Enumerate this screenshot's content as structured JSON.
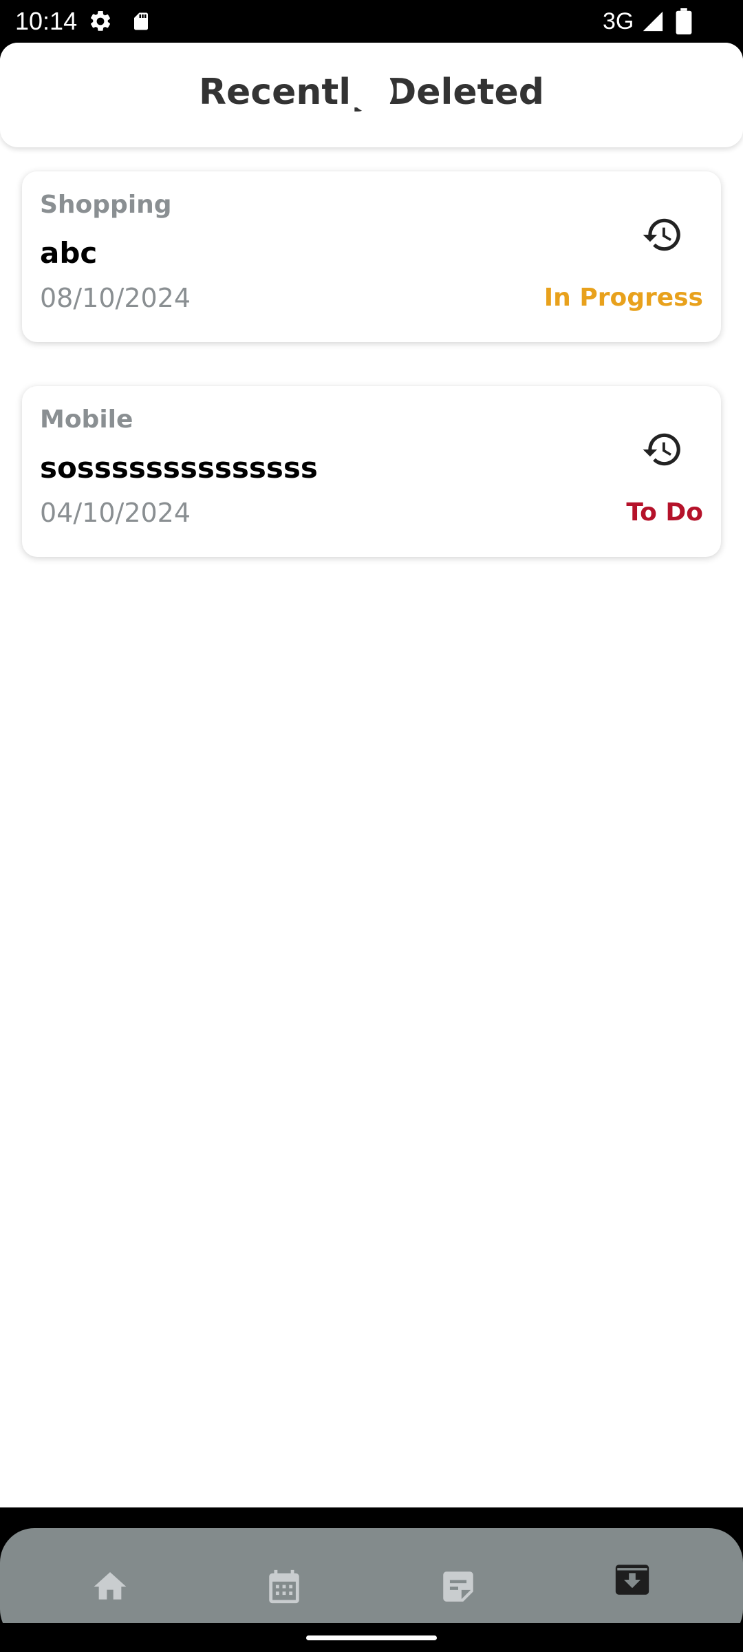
{
  "status_bar": {
    "time": "10:14",
    "network": "3G",
    "icons": [
      "settings-icon",
      "sd-card-icon",
      "signal-icon",
      "battery-icon"
    ]
  },
  "header": {
    "title": "Recently Deleted"
  },
  "cards": [
    {
      "category": "Shopping",
      "title": "abc",
      "date": "08/10/2024",
      "status": "In Progress",
      "status_color": "#e8a11c",
      "action_icon": "restore-history-icon"
    },
    {
      "category": "Mobile",
      "title": "sossssssssssssss",
      "date": "04/10/2024",
      "status": "To Do",
      "status_color": "#b5122a",
      "action_icon": "restore-history-icon"
    }
  ],
  "bottom_nav": {
    "items": [
      {
        "icon": "home-icon",
        "active": false
      },
      {
        "icon": "calendar-icon",
        "active": false
      },
      {
        "icon": "notes-icon",
        "active": false
      },
      {
        "icon": "archive-icon",
        "active": true
      }
    ],
    "background": "#838b8c"
  },
  "colors": {
    "title_text": "#333333",
    "muted_text": "#8a8f92",
    "in_progress": "#e8a11c",
    "to_do": "#b5122a"
  }
}
